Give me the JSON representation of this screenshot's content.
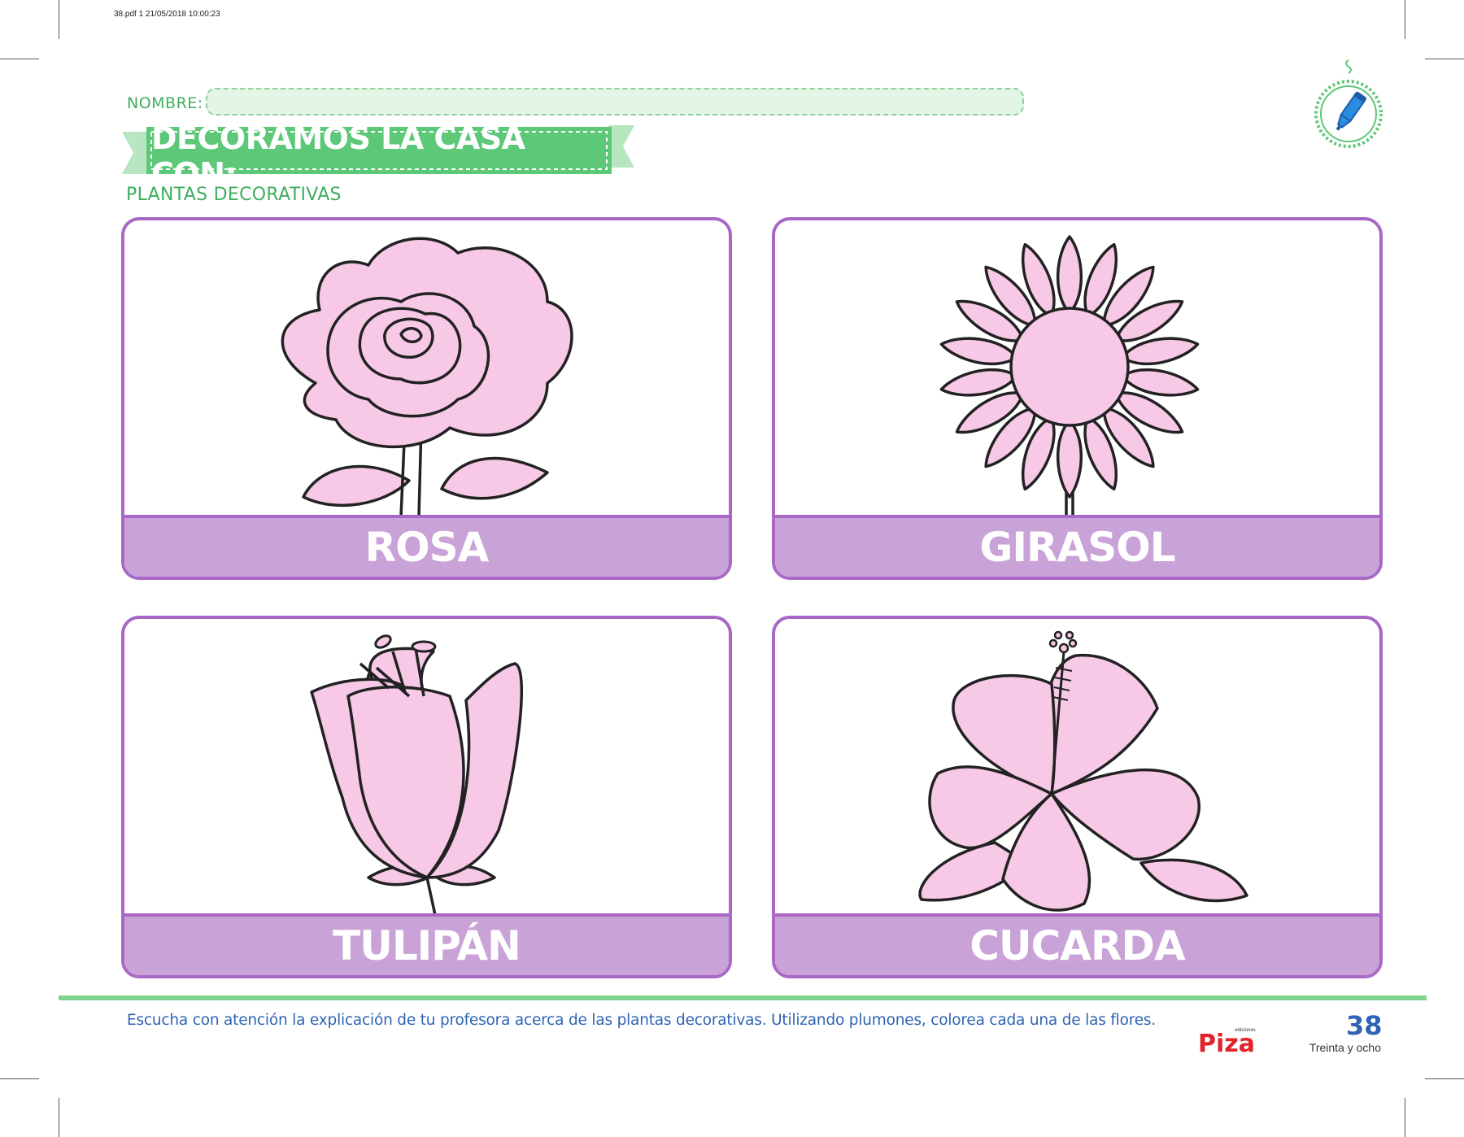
{
  "file_info": "38.pdf   1   21/05/2018   10:00:23",
  "header": {
    "name_label": "NOMBRE:",
    "banner_title": "DECORAMOS LA CASA CON:",
    "subtitle": "PLANTAS DECORATIVAS",
    "badge_icon": "marker-pen-icon"
  },
  "cards": [
    {
      "label": "ROSA",
      "icon": "rose-icon"
    },
    {
      "label": "GIRASOL",
      "icon": "sunflower-icon"
    },
    {
      "label": "TULIPÁN",
      "icon": "tulip-icon"
    },
    {
      "label": "CUCARDA",
      "icon": "hibiscus-icon"
    }
  ],
  "footer": {
    "instruction": "Escucha con atención la explicación de tu profesora acerca de las plantas decorativas. Utilizando plumones, colorea cada una de las flores.",
    "publisher_small": "ediciones",
    "publisher": "Piza",
    "page_number": "38",
    "page_words": "Treinta y ocho"
  },
  "colors": {
    "green_accent": "#3fae5e",
    "banner_green": "#5cc878",
    "card_border": "#a968c6",
    "label_bar": "#c9a2d8",
    "flower_fill": "#f7c9e6",
    "text_blue": "#2f63b4",
    "logo_red": "#e2232a"
  }
}
